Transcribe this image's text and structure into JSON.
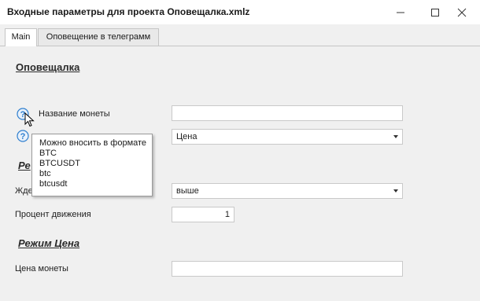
{
  "window": {
    "title": "Входные параметры для проекта Оповещалка.xmlz"
  },
  "tabs": [
    {
      "label": "Main"
    },
    {
      "label": "Оповещение в телеграмм"
    }
  ],
  "sections": {
    "main": "Оповещалка",
    "mode_price": "Режим Цена"
  },
  "fields": {
    "coin_name": {
      "label": "Название монеты",
      "value": ""
    },
    "mode": {
      "value": "Цена",
      "options_visible": [
        "Цена"
      ]
    },
    "wait": {
      "value": "выше"
    },
    "percent": {
      "label": "Процент  движения",
      "value": "1"
    },
    "coin_price": {
      "label": "Цена монеты",
      "value": ""
    }
  },
  "tooltip": {
    "lines": [
      "Можно вносить в формате",
      "BTC",
      "BTCUSDT",
      "btc",
      "btcusdt"
    ]
  },
  "partial_labels": {
    "section_mode_visible": "Ре",
    "wait_label_visible": "Жде"
  },
  "colors": {
    "help_icon": "#2f7fcf",
    "background": "#f0f0f0"
  }
}
